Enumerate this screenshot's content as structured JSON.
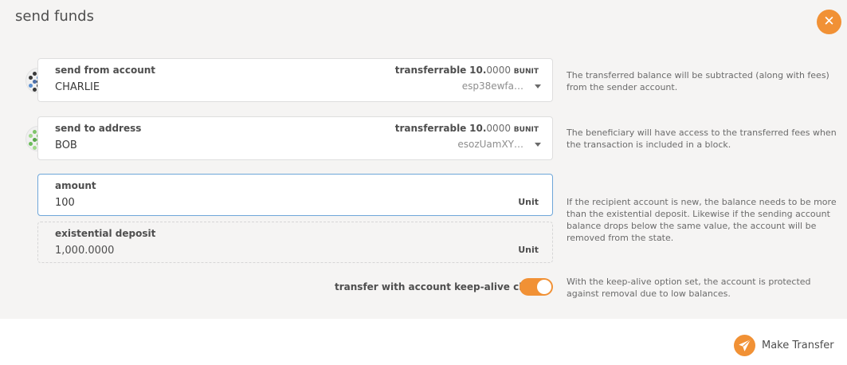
{
  "modal": {
    "title": "send funds",
    "close_icon": "close-icon"
  },
  "from": {
    "label": "send from account",
    "name": "CHARLIE",
    "transferrable_label": "transferrable",
    "balance_int": "10.",
    "balance_dec": "0000",
    "balance_unit": "BUNIT",
    "address": "esp38ewfa…",
    "help": "The transferred balance will be subtracted (along with fees) from the sender account."
  },
  "to": {
    "label": "send to address",
    "name": "BOB",
    "transferrable_label": "transferrable",
    "balance_int": "10.",
    "balance_dec": "0000",
    "balance_unit": "BUNIT",
    "address": "esozUamXY…",
    "help": "The beneficiary will have access to the transferred fees when the transaction is included in a block."
  },
  "amount": {
    "label": "amount",
    "value": "100",
    "unit": "Unit",
    "help": "If the recipient account is new, the balance needs to be more than the existential deposit. Likewise if the sending account balance drops below the same value, the account will be removed from the state."
  },
  "deposit": {
    "label": "existential deposit",
    "value": "1,000.0000",
    "unit": "Unit"
  },
  "keep_alive": {
    "label": "transfer with account keep-alive checks",
    "enabled": true,
    "help": "With the keep-alive option set, the account is protected against removal due to low balances."
  },
  "actions": {
    "make_transfer": "Make Transfer",
    "make_transfer_icon": "paper-plane-icon"
  },
  "colors": {
    "accent": "#f19135",
    "focus_border": "#6ea6d9"
  }
}
